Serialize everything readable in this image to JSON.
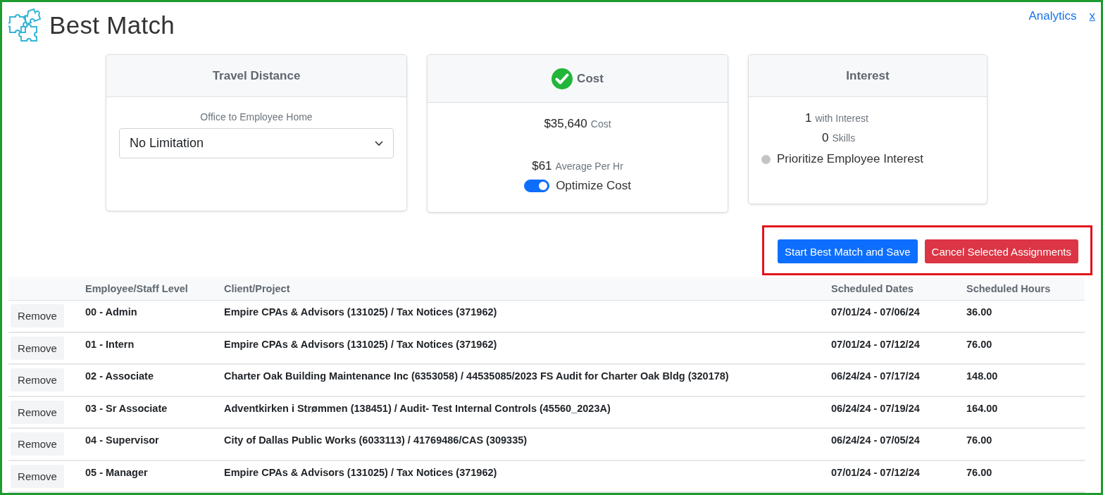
{
  "header": {
    "title": "Best Match",
    "links": [
      {
        "label": "Analytics",
        "kind": "plain"
      },
      {
        "label": "x",
        "kind": "underlined"
      }
    ]
  },
  "cards": [
    {
      "kind": "select",
      "title": "Travel Distance",
      "achieved": false,
      "label": "Office to Employee Home",
      "value": "No Limitation"
    },
    {
      "kind": "cost",
      "title": "Cost",
      "achieved": true,
      "stats": [
        {
          "value": "$35,640",
          "label": "Cost"
        },
        {
          "value": "$61",
          "label": "Average Per Hr"
        }
      ],
      "toggle": {
        "label": "Optimize Cost",
        "on": true
      }
    },
    {
      "kind": "interest",
      "title": "Interest",
      "achieved": false,
      "stats": [
        {
          "value": "1",
          "label": "with Interest"
        },
        {
          "value": "0",
          "label": "Skills"
        }
      ],
      "option": {
        "label": "Prioritize Employee Interest",
        "selected": false
      }
    }
  ],
  "actions": [
    {
      "label": "Start Best Match and Save",
      "kind": "primary"
    },
    {
      "label": "Cancel Selected Assignments",
      "kind": "danger"
    }
  ],
  "table": {
    "columns": [
      "Employee/Staff Level",
      "Client/Project",
      "Scheduled Dates",
      "Scheduled Hours"
    ],
    "rows": [
      {
        "action": "Remove",
        "cells": [
          "00 - Admin",
          "Empire CPAs & Advisors (131025) / Tax Notices (371962)",
          "07/01/24 - 07/06/24",
          "36.00"
        ]
      },
      {
        "action": "Remove",
        "cells": [
          "01 - Intern",
          "Empire CPAs & Advisors (131025) / Tax Notices (371962)",
          "07/01/24 - 07/12/24",
          "76.00"
        ]
      },
      {
        "action": "Remove",
        "cells": [
          "02 - Associate",
          "Charter Oak Building Maintenance Inc (6353058) / 44535085/2023 FS Audit for Charter Oak Bldg (320178)",
          "06/24/24 - 07/17/24",
          "148.00"
        ]
      },
      {
        "action": "Remove",
        "cells": [
          "03 - Sr Associate",
          "Adventkirken i Strømmen (138451) / Audit- Test Internal Controls (45560_2023A)",
          "06/24/24 - 07/19/24",
          "164.00"
        ]
      },
      {
        "action": "Remove",
        "cells": [
          "04 - Supervisor",
          "City of Dallas Public Works (6033113) / 41769486/CAS (309335)",
          "06/24/24 - 07/05/24",
          "76.00"
        ]
      },
      {
        "action": "Remove",
        "cells": [
          "05 - Manager",
          "Empire CPAs & Advisors (131025) / Tax Notices (371962)",
          "07/01/24 - 07/12/24",
          "76.00"
        ]
      }
    ]
  }
}
